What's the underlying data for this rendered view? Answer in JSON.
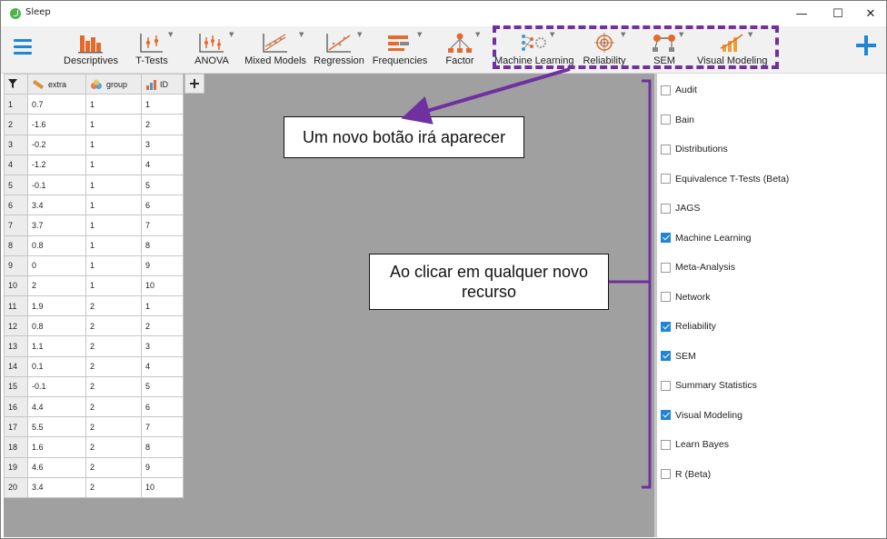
{
  "window": {
    "title": "Sleep"
  },
  "window_controls": {
    "minimize": "—",
    "maximize": "☐",
    "close": "✕"
  },
  "ribbon": {
    "tools": [
      {
        "label": "Descriptives",
        "icon": "descriptives-icon"
      },
      {
        "label": "T-Tests",
        "icon": "t-tests-icon"
      },
      {
        "label": "ANOVA",
        "icon": "anova-icon"
      },
      {
        "label": "Mixed Models",
        "icon": "mixed-models-icon"
      },
      {
        "label": "Regression",
        "icon": "regression-icon"
      },
      {
        "label": "Frequencies",
        "icon": "frequencies-icon"
      },
      {
        "label": "Factor",
        "icon": "factor-icon"
      },
      {
        "label": "Machine Learning",
        "icon": "machine-learning-icon"
      },
      {
        "label": "Reliability",
        "icon": "reliability-icon"
      },
      {
        "label": "SEM",
        "icon": "sem-icon"
      },
      {
        "label": "Visual Modeling",
        "icon": "visual-modeling-icon"
      }
    ]
  },
  "table": {
    "columns": [
      "extra",
      "group",
      "ID"
    ],
    "rows": [
      [
        "1",
        "0.7",
        "1",
        "1"
      ],
      [
        "2",
        "-1.6",
        "1",
        "2"
      ],
      [
        "3",
        "-0.2",
        "1",
        "3"
      ],
      [
        "4",
        "-1.2",
        "1",
        "4"
      ],
      [
        "5",
        "-0.1",
        "1",
        "5"
      ],
      [
        "6",
        "3.4",
        "1",
        "6"
      ],
      [
        "7",
        "3.7",
        "1",
        "7"
      ],
      [
        "8",
        "0.8",
        "1",
        "8"
      ],
      [
        "9",
        "0",
        "1",
        "9"
      ],
      [
        "10",
        "2",
        "1",
        "10"
      ],
      [
        "11",
        "1.9",
        "2",
        "1"
      ],
      [
        "12",
        "0.8",
        "2",
        "2"
      ],
      [
        "13",
        "1.1",
        "2",
        "3"
      ],
      [
        "14",
        "0.1",
        "2",
        "4"
      ],
      [
        "15",
        "-0.1",
        "2",
        "5"
      ],
      [
        "16",
        "4.4",
        "2",
        "6"
      ],
      [
        "17",
        "5.5",
        "2",
        "7"
      ],
      [
        "18",
        "1.6",
        "2",
        "8"
      ],
      [
        "19",
        "4.6",
        "2",
        "9"
      ],
      [
        "20",
        "3.4",
        "2",
        "10"
      ]
    ]
  },
  "modules": [
    {
      "label": "Audit",
      "checked": false
    },
    {
      "label": "Bain",
      "checked": false
    },
    {
      "label": "Distributions",
      "checked": false
    },
    {
      "label": "Equivalence T-Tests (Beta)",
      "checked": false
    },
    {
      "label": "JAGS",
      "checked": false
    },
    {
      "label": "Machine Learning",
      "checked": true
    },
    {
      "label": "Meta-Analysis",
      "checked": false
    },
    {
      "label": "Network",
      "checked": false
    },
    {
      "label": "Reliability",
      "checked": true
    },
    {
      "label": "SEM",
      "checked": true
    },
    {
      "label": "Summary Statistics",
      "checked": false
    },
    {
      "label": "Visual Modeling",
      "checked": true
    },
    {
      "label": "Learn Bayes",
      "checked": false
    },
    {
      "label": "R (Beta)",
      "checked": false
    }
  ],
  "annotations": {
    "top": "Um novo botão irá aparecer",
    "middle_line1": "Ao clicar em qualquer novo",
    "middle_line2": "recurso"
  },
  "colors": {
    "accent": "#1f86d6",
    "annotation": "#7030a0",
    "data_bg": "#a0a0a0"
  }
}
